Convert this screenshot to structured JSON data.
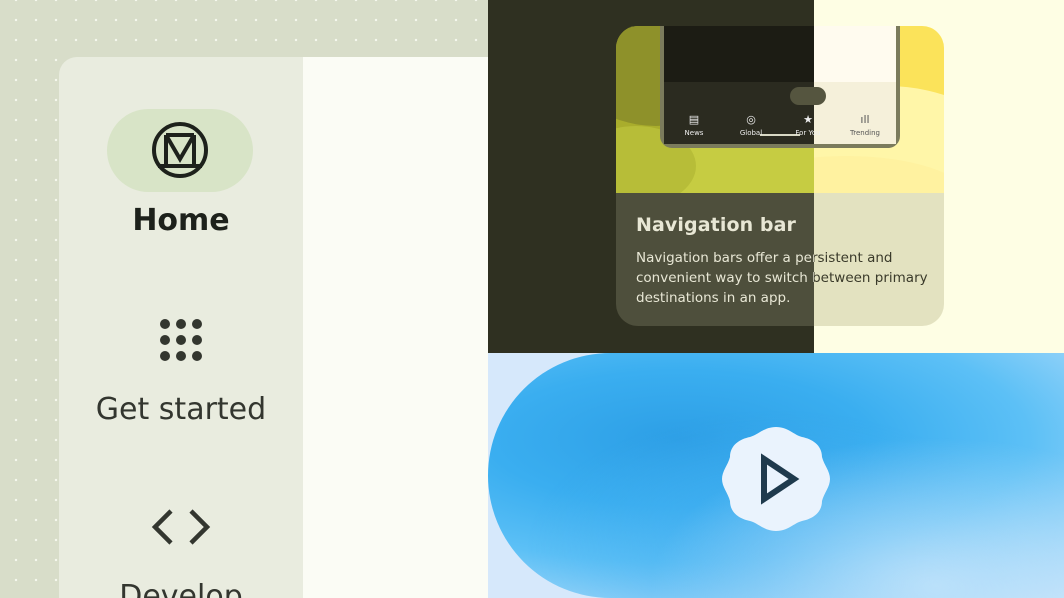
{
  "rail": {
    "items": [
      {
        "label": "Home",
        "icon": "material-logo-icon",
        "active": true
      },
      {
        "label": "Get started",
        "icon": "apps-grid-icon"
      },
      {
        "label": "Develop",
        "icon": "code-icon"
      }
    ]
  },
  "card": {
    "title": "Navigation bar",
    "description": "Navigation bars offer a persistent and convenient way to switch between primary destinations in an app.",
    "preview_nav": [
      {
        "label": "News",
        "icon": "news-icon"
      },
      {
        "label": "Global",
        "icon": "globe-icon"
      },
      {
        "label": "For You",
        "icon": "star-icon"
      },
      {
        "label": "Trending",
        "icon": "trending-icon"
      }
    ]
  },
  "colors": {
    "dark_bg": "#2f3021",
    "light_bg": "#fefee4",
    "rail_bg": "#e9ecdf",
    "pill": "#d8e4c7",
    "blue": "#3aaef0"
  },
  "video": {
    "icon": "play-icon"
  }
}
